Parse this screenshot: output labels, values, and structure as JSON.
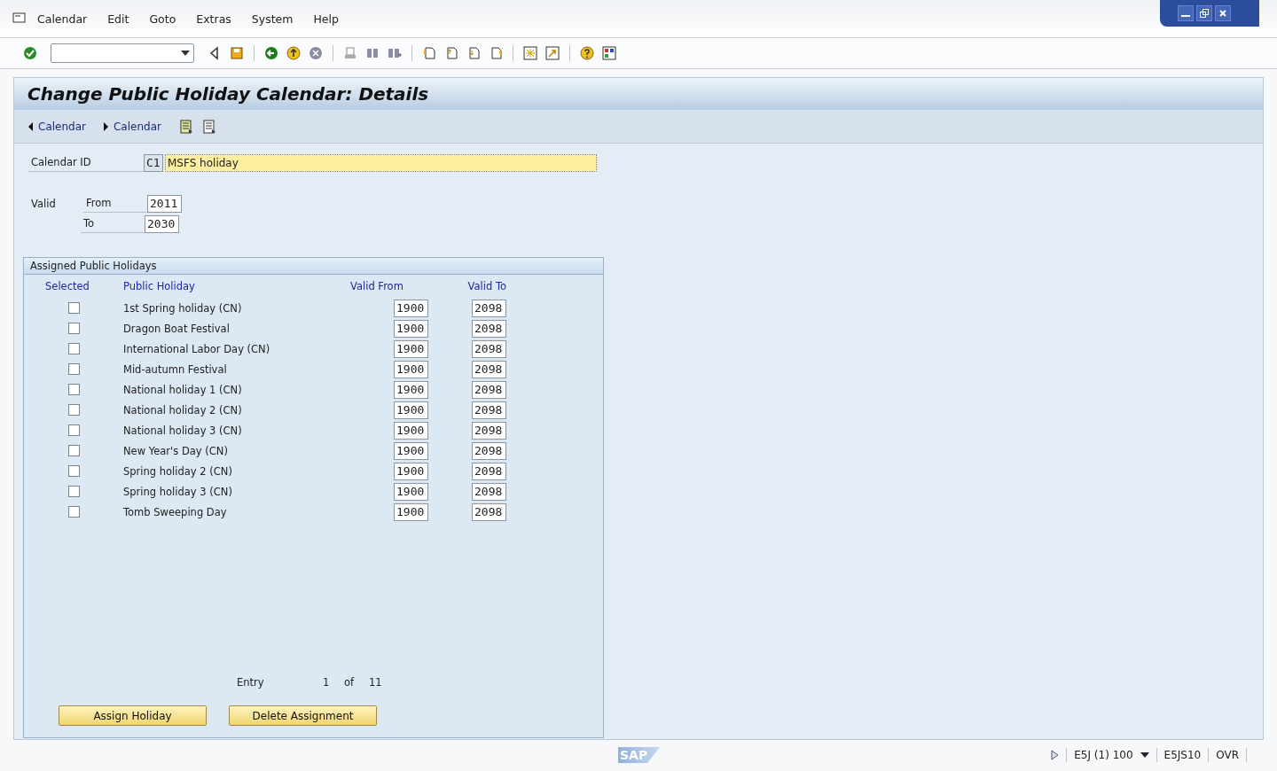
{
  "menu": [
    "Calendar",
    "Edit",
    "Goto",
    "Extras",
    "System",
    "Help"
  ],
  "screen": {
    "title": "Change Public Holiday Calendar: Details",
    "app_toolbar": [
      {
        "kind": "prev",
        "label": "Calendar"
      },
      {
        "kind": "next",
        "label": "Calendar"
      }
    ],
    "calendar_id": {
      "label": "Calendar ID",
      "code": "C1",
      "description": "MSFS holiday"
    },
    "valid": {
      "label": "Valid",
      "from_label": "From",
      "from": "2011",
      "to_label": "To",
      "to": "2030"
    },
    "group": {
      "title": "Assigned Public Holidays",
      "columns": [
        "Selected",
        "Public Holiday",
        "Valid From",
        "Valid To"
      ],
      "rows": [
        {
          "checked": false,
          "name": "1st Spring holiday (CN)",
          "valid_from": "1900",
          "valid_to": "2098"
        },
        {
          "checked": false,
          "name": "Dragon Boat Festival",
          "valid_from": "1900",
          "valid_to": "2098"
        },
        {
          "checked": false,
          "name": "International Labor Day (CN)",
          "valid_from": "1900",
          "valid_to": "2098"
        },
        {
          "checked": false,
          "name": "Mid-autumn Festival",
          "valid_from": "1900",
          "valid_to": "2098"
        },
        {
          "checked": false,
          "name": "National holiday 1 (CN)",
          "valid_from": "1900",
          "valid_to": "2098"
        },
        {
          "checked": false,
          "name": "National holiday 2 (CN)",
          "valid_from": "1900",
          "valid_to": "2098"
        },
        {
          "checked": false,
          "name": "National holiday 3 (CN)",
          "valid_from": "1900",
          "valid_to": "2098"
        },
        {
          "checked": false,
          "name": "New Year's Day (CN)",
          "valid_from": "1900",
          "valid_to": "2098"
        },
        {
          "checked": false,
          "name": "Spring holiday 2 (CN)",
          "valid_from": "1900",
          "valid_to": "2098"
        },
        {
          "checked": false,
          "name": "Spring holiday 3 (CN)",
          "valid_from": "1900",
          "valid_to": "2098"
        },
        {
          "checked": false,
          "name": "Tomb Sweeping Day",
          "valid_from": "1900",
          "valid_to": "2098"
        }
      ],
      "entry": {
        "label": "Entry",
        "current": "1",
        "of": "of",
        "total": "11"
      },
      "buttons": [
        "Assign Holiday",
        "Delete Assignment"
      ]
    }
  },
  "status_bar": {
    "logo": "SAP",
    "system": "E5J (1) 100",
    "server": "E5JS10",
    "mode": "OVR"
  }
}
